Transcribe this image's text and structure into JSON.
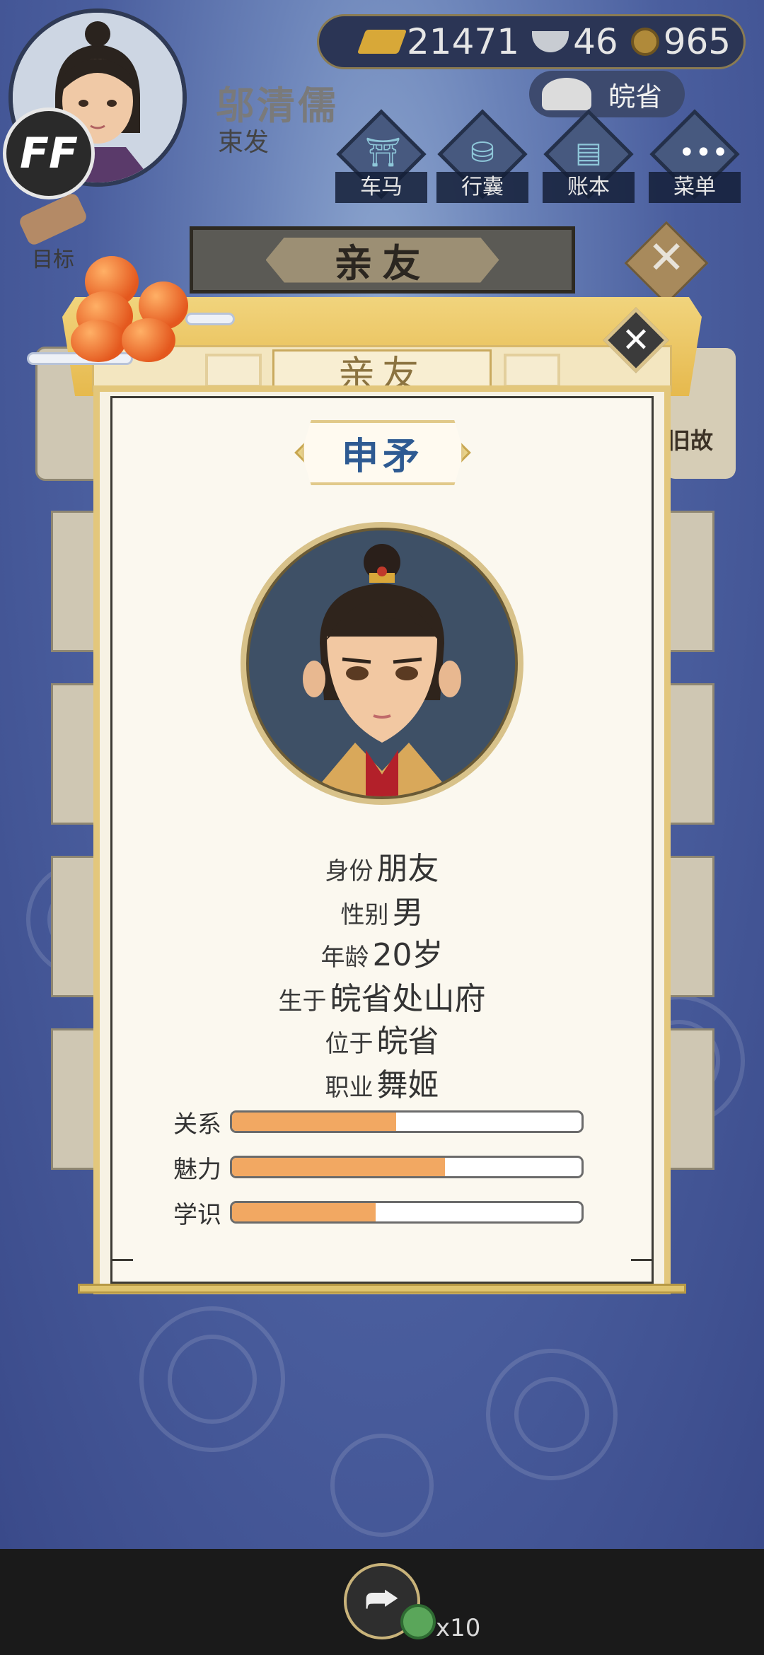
{
  "player": {
    "name": "邬清儒",
    "hair": "束发"
  },
  "ff_badge": "FF",
  "goal_label": "目标",
  "currency": {
    "gold": "21471",
    "silver": "46",
    "coins": "965"
  },
  "province_button": "皖省",
  "top_nav": [
    {
      "label": "车马",
      "icon": "carriage-icon"
    },
    {
      "label": "行囊",
      "icon": "bag-icon"
    },
    {
      "label": "账本",
      "icon": "ledger-icon"
    },
    {
      "label": "菜单",
      "icon": "menu-dots-icon"
    }
  ],
  "background_page": {
    "title": "亲友",
    "side_tab": "旧故"
  },
  "dialog": {
    "title": "亲友",
    "name": "申矛",
    "info": [
      {
        "key": "身份",
        "value": "朋友"
      },
      {
        "key": "性别",
        "value": "男"
      },
      {
        "key": "年龄",
        "value": "20岁"
      },
      {
        "key": "生于",
        "value": "皖省处山府"
      },
      {
        "key": "位于",
        "value": "皖省"
      },
      {
        "key": "职业",
        "value": "舞姬"
      }
    ],
    "stats": [
      {
        "label": "关系",
        "fraction": 0.47
      },
      {
        "label": "魅力",
        "fraction": 0.61
      },
      {
        "label": "学识",
        "fraction": 0.41
      }
    ]
  },
  "bottom": {
    "share_count": "x10"
  },
  "colors": {
    "stat_fill": "#f2a862",
    "name_text": "#2e5a92",
    "dialog_gold": "#e3c77c",
    "background": "#4a5e9e"
  }
}
